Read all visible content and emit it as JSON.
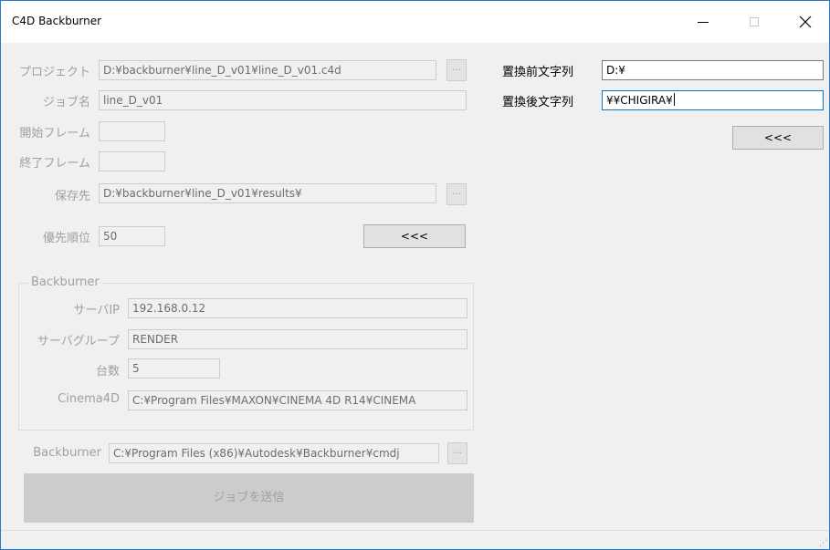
{
  "window": {
    "title": "C4D Backburner"
  },
  "form": {
    "project_label": "プロジェクト",
    "project_value": "D:¥backburner¥line_D_v01¥line_D_v01.c4d",
    "jobname_label": "ジョブ名",
    "jobname_value": "line_D_v01",
    "start_frame_label": "開始フレーム",
    "start_frame_value": "",
    "end_frame_label": "終了フレーム",
    "end_frame_value": "",
    "save_label": "保存先",
    "save_value": "D:¥backburner¥line_D_v01¥results¥",
    "priority_label": "優先順位",
    "priority_value": "50",
    "apply_button_label": "<<<",
    "browse_label": "..."
  },
  "backburner_group": {
    "title": "Backburner",
    "server_ip_label": "サーバIP",
    "server_ip_value": "192.168.0.12",
    "server_group_label": "サーバグループ",
    "server_group_value": "RENDER",
    "count_label": "台数",
    "count_value": "5",
    "cinema4d_label": "Cinema4D",
    "cinema4d_value": "C:¥Program Files¥MAXON¥CINEMA 4D R14¥CINEMA"
  },
  "backburner_path": {
    "label": "Backburner",
    "value": "C:¥Program Files (x86)¥Autodesk¥Backburner¥cmdj"
  },
  "submit_label": "ジョブを送信",
  "replace": {
    "before_label": "置換前文字列",
    "before_value": "D:¥",
    "after_label": "置換後文字列",
    "after_value": "¥¥CHIGIRA¥",
    "button_label": "<<<"
  },
  "icons": {
    "minimize": "minimize-icon",
    "maximize": "maximize-icon",
    "close": "close-icon"
  }
}
